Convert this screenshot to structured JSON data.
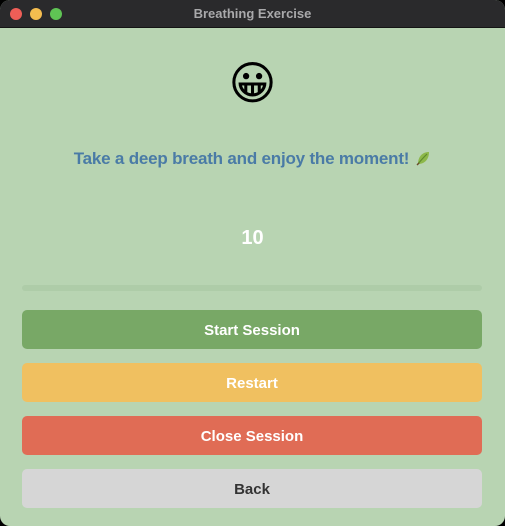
{
  "window": {
    "title": "Breathing Exercise"
  },
  "main": {
    "emoji": "😀",
    "message": "Take a deep breath and enjoy the moment!",
    "message_icon": "leaf-icon",
    "counter": "10",
    "progress_fraction": 0
  },
  "buttons": {
    "start_label": "Start Session",
    "restart_label": "Restart",
    "close_label": "Close Session",
    "back_label": "Back"
  },
  "colors": {
    "background": "#b8d4b2",
    "message": "#4a7ba6",
    "start": "#78a866",
    "restart": "#f0c060",
    "close": "#e06c55",
    "back": "#d6d6d6"
  }
}
